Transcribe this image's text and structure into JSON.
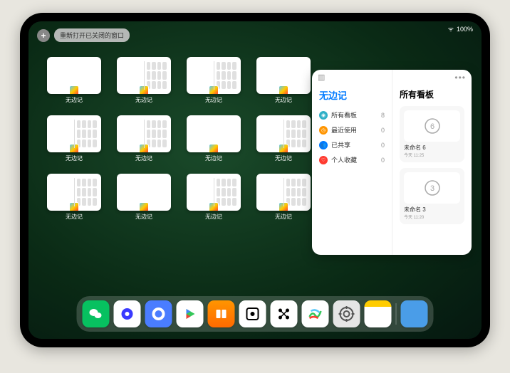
{
  "status": {
    "wifi": "ᯤ",
    "battery": "100%"
  },
  "controls": {
    "plus_label": "+",
    "reopen_label": "重新打开已关闭的窗口"
  },
  "window_label": "无边记",
  "windows": [
    {
      "dual": false
    },
    {
      "dual": true
    },
    {
      "dual": true
    },
    {
      "dual": false
    },
    {
      "dual": true
    },
    {
      "dual": true
    },
    {
      "dual": false
    },
    {
      "dual": true
    },
    {
      "dual": true
    },
    {
      "dual": false
    },
    {
      "dual": true
    },
    {
      "dual": true
    }
  ],
  "panel": {
    "title": "无边记",
    "right_title": "所有看板",
    "items": [
      {
        "icon": "blue",
        "glyph": "◉",
        "label": "所有看板",
        "count": "8"
      },
      {
        "icon": "orange",
        "glyph": "◷",
        "label": "最近使用",
        "count": "0"
      },
      {
        "icon": "dblue",
        "glyph": "👥",
        "label": "已共享",
        "count": "0"
      },
      {
        "icon": "red",
        "glyph": "♡",
        "label": "个人收藏",
        "count": "0"
      }
    ],
    "boards": [
      {
        "glyph": "6",
        "name": "未命名 6",
        "time": "今天 11:25"
      },
      {
        "glyph": "3",
        "name": "未命名 3",
        "time": "今天 11:20"
      }
    ]
  },
  "dock": [
    {
      "name": "wechat",
      "cls": "di-wechat"
    },
    {
      "name": "quark",
      "cls": "di-q1"
    },
    {
      "name": "qqbrowser",
      "cls": "di-q2"
    },
    {
      "name": "play",
      "cls": "di-play"
    },
    {
      "name": "books",
      "cls": "di-books"
    },
    {
      "name": "app6",
      "cls": "di-dice"
    },
    {
      "name": "app7",
      "cls": "di-grid"
    },
    {
      "name": "freeform",
      "cls": "di-freeform"
    },
    {
      "name": "settings",
      "cls": "di-settings"
    },
    {
      "name": "notes",
      "cls": "di-notes"
    },
    {
      "name": "recent-stack",
      "cls": "di-stack"
    }
  ]
}
